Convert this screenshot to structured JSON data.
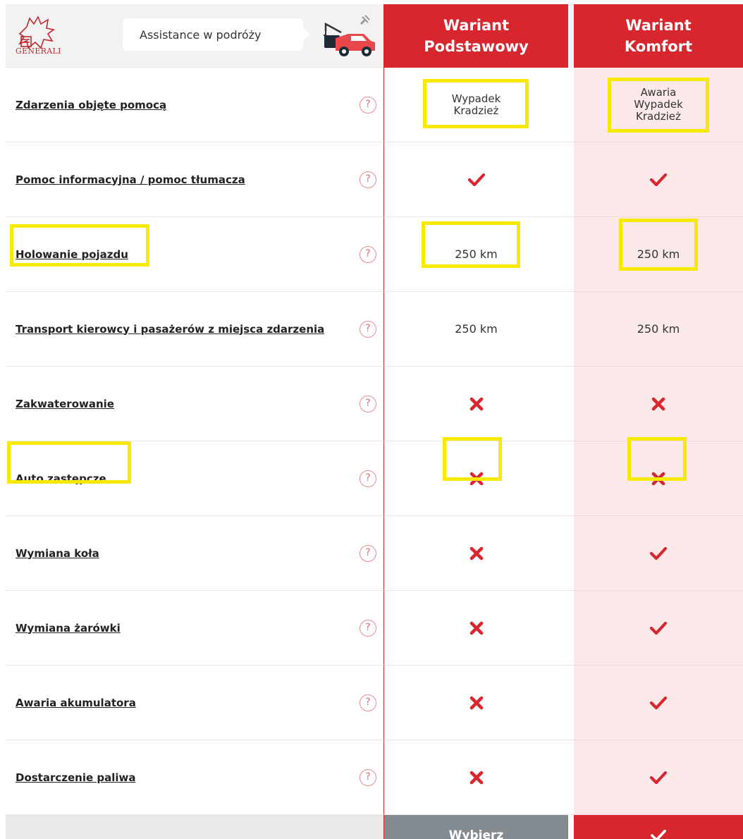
{
  "brand": {
    "name": "GENERALI",
    "accent": "#d7262e",
    "highlight": "#f7ea00"
  },
  "header": {
    "product": "Assistance w podróży",
    "variants": [
      {
        "line1": "Wariant",
        "line2": "Podstawowy"
      },
      {
        "line1": "Wariant",
        "line2": "Komfort"
      }
    ]
  },
  "rows": [
    {
      "label": "Zdarzenia objęte pomocą",
      "basic": {
        "type": "text",
        "text": "Wypadek\nKradzież"
      },
      "comfort": {
        "type": "text",
        "text": "Awaria\nWypadek\nKradzież"
      }
    },
    {
      "label": "Pomoc informacyjna / pomoc tłumacza",
      "basic": {
        "type": "check"
      },
      "comfort": {
        "type": "check"
      }
    },
    {
      "label": "Holowanie pojazdu",
      "basic": {
        "type": "text",
        "text": "250 km"
      },
      "comfort": {
        "type": "text",
        "text": "250 km"
      }
    },
    {
      "label": "Transport kierowcy i pasażerów z miejsca zdarzenia",
      "basic": {
        "type": "text",
        "text": "250 km"
      },
      "comfort": {
        "type": "text",
        "text": "250 km"
      }
    },
    {
      "label": "Zakwaterowanie",
      "basic": {
        "type": "cross"
      },
      "comfort": {
        "type": "cross"
      }
    },
    {
      "label": "Auto zastępcze",
      "basic": {
        "type": "cross"
      },
      "comfort": {
        "type": "cross"
      }
    },
    {
      "label": "Wymiana koła",
      "basic": {
        "type": "cross"
      },
      "comfort": {
        "type": "check"
      }
    },
    {
      "label": "Wymiana żarówki",
      "basic": {
        "type": "cross"
      },
      "comfort": {
        "type": "check"
      }
    },
    {
      "label": "Awaria akumulatora",
      "basic": {
        "type": "cross"
      },
      "comfort": {
        "type": "check"
      }
    },
    {
      "label": "Dostarczenie paliwa",
      "basic": {
        "type": "cross"
      },
      "comfort": {
        "type": "check"
      }
    }
  ],
  "help_glyph": "?",
  "footer": {
    "basic_button": "Wybierz",
    "comfort_selected_icon": "check-icon"
  }
}
